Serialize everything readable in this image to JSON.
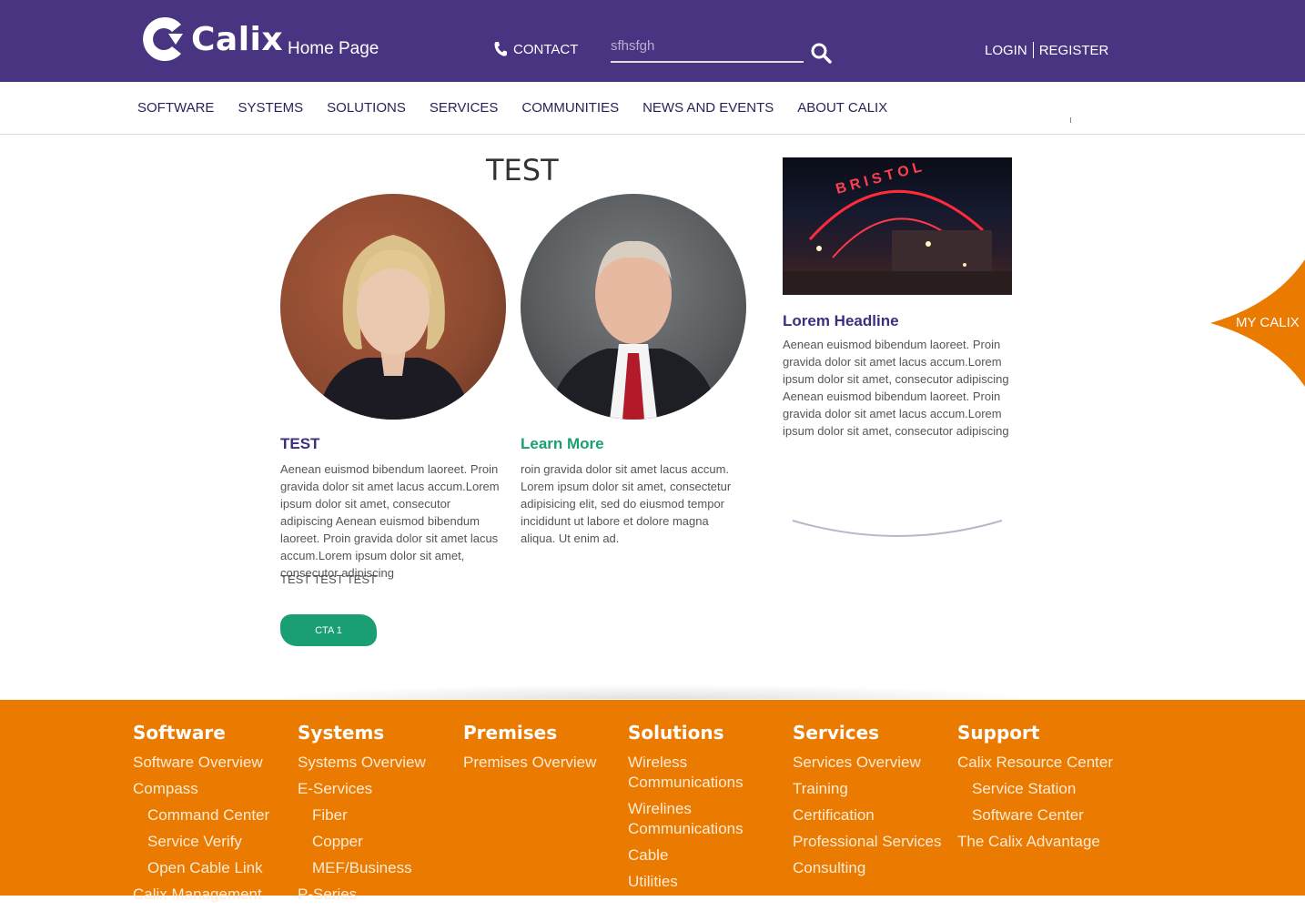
{
  "header": {
    "logo_text": "Calix",
    "page_title": "Home Page",
    "contact_label": "CONTACT",
    "search_value": "sfhsfgh",
    "login_label": "LOGIN",
    "register_label": "REGISTER",
    "brand_color": "#483481"
  },
  "nav": {
    "items": [
      "SOFTWARE",
      "SYSTEMS",
      "SOLUTIONS",
      "SERVICES",
      "COMMUNITIES",
      "NEWS AND EVENTS",
      "ABOUT CALIX"
    ]
  },
  "main": {
    "title": "TEST",
    "cards": [
      {
        "title": "TEST",
        "title_color": "#3f2d7d",
        "body": "Aenean euismod bibendum laoreet. Proin gravida dolor sit amet lacus accum.Lorem ipsum dolor sit amet, consecutor adipiscing Aenean euismod bibendum laoreet. Proin gravida dolor sit amet lacus accum.Lorem ipsum dolor sit amet, consecutor adipiscing"
      },
      {
        "title": "Learn More",
        "title_color": "#1a9e73",
        "body": "roin gravida dolor sit amet lacus accum. Lorem ipsum dolor sit amet, consectetur adipisicing elit, sed do eiusmod tempor incididunt ut labore et dolore magna aliqua. Ut enim ad."
      }
    ],
    "test_text": "TEST TEST TEST",
    "cta_label": "CTA 1",
    "cta_color": "#1a9e73",
    "sidebar": {
      "headline": "Lorem Headline",
      "body": "Aenean euismod bibendum laoreet. Proin gravida dolor sit amet lacus accum.Lorem ipsum dolor sit amet, consecutor adipiscing Aenean euismod bibendum laoreet. Proin gravida dolor sit amet lacus accum.Lorem ipsum dolor sit amet, consecutor adipiscing"
    },
    "mycalix_label": "MY CALIX"
  },
  "footer": {
    "color": "#ea7a00",
    "columns": [
      {
        "heading": "Software",
        "links": [
          {
            "text": "Software Overview",
            "sub": false
          },
          {
            "text": "Compass",
            "sub": false
          },
          {
            "text": "Command Center",
            "sub": true
          },
          {
            "text": "Service Verify",
            "sub": true
          },
          {
            "text": "Open Cable Link",
            "sub": true
          },
          {
            "text": "Calix Management",
            "sub": false
          }
        ]
      },
      {
        "heading": "Systems",
        "links": [
          {
            "text": "Systems Overview",
            "sub": false
          },
          {
            "text": "E-Services",
            "sub": false
          },
          {
            "text": "Fiber",
            "sub": true
          },
          {
            "text": "Copper",
            "sub": true
          },
          {
            "text": "MEF/Business",
            "sub": true
          },
          {
            "text": "P-Series",
            "sub": false
          }
        ]
      },
      {
        "heading": "Premises",
        "links": [
          {
            "text": "Premises Overview",
            "sub": false
          }
        ]
      },
      {
        "heading": "Solutions",
        "links": [
          {
            "text": "Wireless Communications",
            "sub": false
          },
          {
            "text": "Wirelines Communications",
            "sub": false
          },
          {
            "text": "Cable",
            "sub": false
          },
          {
            "text": "Utilities",
            "sub": false
          }
        ]
      },
      {
        "heading": "Services",
        "links": [
          {
            "text": "Services Overview",
            "sub": false
          },
          {
            "text": "Training",
            "sub": false
          },
          {
            "text": "Certification",
            "sub": false
          },
          {
            "text": "Professional Services",
            "sub": false
          },
          {
            "text": "Consulting",
            "sub": false
          }
        ]
      },
      {
        "heading": "Support",
        "links": [
          {
            "text": "Calix Resource Center",
            "sub": false
          },
          {
            "text": "Service Station",
            "sub": true
          },
          {
            "text": "Software Center",
            "sub": true
          },
          {
            "text": "The Calix Advantage",
            "sub": false
          }
        ]
      }
    ]
  }
}
